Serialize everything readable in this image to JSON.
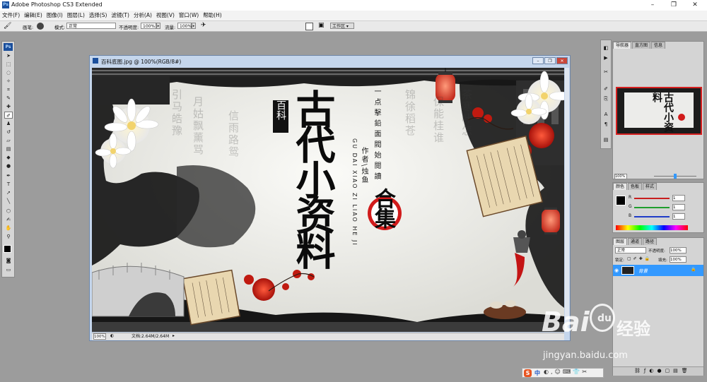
{
  "window": {
    "title": "Adobe Photoshop CS3 Extended",
    "minimize": "–",
    "maximize": "❐",
    "close": "✕"
  },
  "menu": [
    "文件(F)",
    "编辑(E)",
    "图像(I)",
    "图层(L)",
    "选择(S)",
    "滤镜(T)",
    "分析(A)",
    "视图(V)",
    "窗口(W)",
    "帮助(H)"
  ],
  "options": {
    "brush_label": "画笔:",
    "mode_label": "模式:",
    "mode_value": "正常",
    "opacity_label": "不透明度:",
    "opacity_value": "100%",
    "flow_label": "流量:",
    "flow_value": "100%",
    "workspace": "工作区 ▾"
  },
  "toolbox": {
    "logo": "Ps"
  },
  "document": {
    "title": "百科底图.jpg @ 100%(RGB/8#)",
    "zoom": "100%",
    "doc_info": "文档:2.64M/2.64M"
  },
  "artwork": {
    "badge": "百科",
    "main_title": "古代小资料",
    "tagline": "一点擊鉛面閥始閱讀",
    "pinyin": "GU DAI XIAO ZI LIAO HE JI",
    "author": "作者\\烛鱼",
    "heji": "合集"
  },
  "navigator": {
    "tabs": [
      "导航器",
      "直方图",
      "信息"
    ],
    "zoom": "100%"
  },
  "color_panel": {
    "tabs": [
      "颜色",
      "色板",
      "样式"
    ],
    "r_label": "R",
    "g_label": "G",
    "b_label": "B",
    "r_value": "1",
    "g_value": "1",
    "b_value": "1"
  },
  "layers": {
    "tabs": [
      "图层",
      "通道",
      "路径"
    ],
    "mode_value": "正常",
    "opacity_label": "不透明度:",
    "opacity_value": "100%",
    "lock_label": "锁定:",
    "fill_label": "填充:",
    "fill_value": "100%",
    "layer_name": "背景"
  },
  "watermark": {
    "brand": "Bai",
    "paw": "du",
    "cn": "经验",
    "url": "jingyan.baidu.com"
  },
  "ime": {
    "logo": "S",
    "lang": "中"
  },
  "colors": {
    "accent": "#3399ff",
    "ps_blue": "#1b4f9c",
    "close_red": "#c9473a"
  }
}
